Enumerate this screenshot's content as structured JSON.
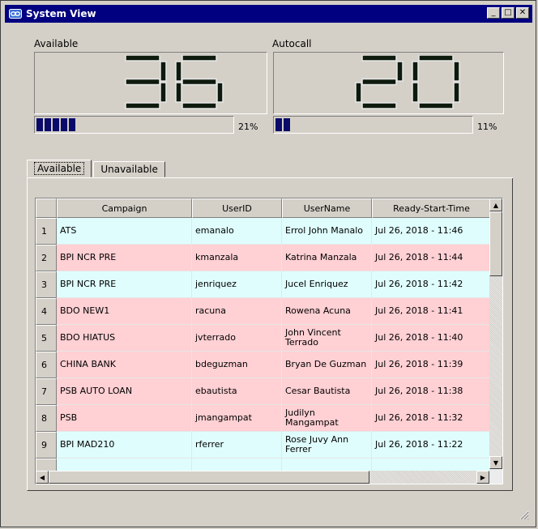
{
  "window": {
    "title": "System View",
    "icon": "link-icon",
    "buttons": {
      "minimize": "_",
      "maximize": "□",
      "close": "✕"
    }
  },
  "available": {
    "label": "Available",
    "value": "36",
    "percent": 21,
    "percent_label": "21%",
    "blocks": 5
  },
  "autocall": {
    "label": "Autocall",
    "value": "20",
    "percent": 11,
    "percent_label": "11%",
    "blocks": 2
  },
  "tabs": [
    {
      "label": "Available",
      "active": true
    },
    {
      "label": "Unavailable",
      "active": false
    }
  ],
  "table": {
    "columns": [
      "Campaign",
      "UserID",
      "UserName",
      "Ready-Start-Time"
    ],
    "rows": [
      {
        "num": "1",
        "campaign": "ATS",
        "userid": "emanalo",
        "username": "Errol John Manalo",
        "time": "Jul 26, 2018 - 11:46",
        "color": "teal"
      },
      {
        "num": "2",
        "campaign": "BPI NCR PRE",
        "userid": "kmanzala",
        "username": "Katrina Manzala",
        "time": "Jul 26, 2018 - 11:44",
        "color": "pink"
      },
      {
        "num": "3",
        "campaign": "BPI NCR PRE",
        "userid": "jenriquez",
        "username": "Jucel Enriquez",
        "time": "Jul 26, 2018 - 11:42",
        "color": "teal"
      },
      {
        "num": "4",
        "campaign": "BDO NEW1",
        "userid": "racuna",
        "username": "Rowena Acuna",
        "time": "Jul 26, 2018 - 11:41",
        "color": "pink"
      },
      {
        "num": "5",
        "campaign": "BDO HIATUS",
        "userid": "jvterrado",
        "username": "John Vincent Terrado",
        "time": "Jul 26, 2018 - 11:40",
        "color": "pink"
      },
      {
        "num": "6",
        "campaign": "CHINA BANK",
        "userid": "bdeguzman",
        "username": "Bryan De Guzman",
        "time": "Jul 26, 2018 - 11:39",
        "color": "pink"
      },
      {
        "num": "7",
        "campaign": "PSB AUTO LOAN",
        "userid": "ebautista",
        "username": "Cesar Bautista",
        "time": "Jul 26, 2018 - 11:38",
        "color": "pink"
      },
      {
        "num": "8",
        "campaign": "PSB",
        "userid": "jmangampat",
        "username": "Judilyn Mangampat",
        "time": "Jul 26, 2018 - 11:32",
        "color": "pink"
      },
      {
        "num": "9",
        "campaign": "BPI MAD210",
        "userid": "rferrer",
        "username": "Rose Juvy Ann Ferrer",
        "time": "Jul 26, 2018 - 11:22",
        "color": "teal"
      }
    ]
  },
  "colors": {
    "titlebar": "#000080",
    "teal_row": "#dffdfd",
    "pink_row": "#ffd0d4",
    "progress_block": "#0a0a6a",
    "lcd_digit": "#0d1a0d"
  }
}
